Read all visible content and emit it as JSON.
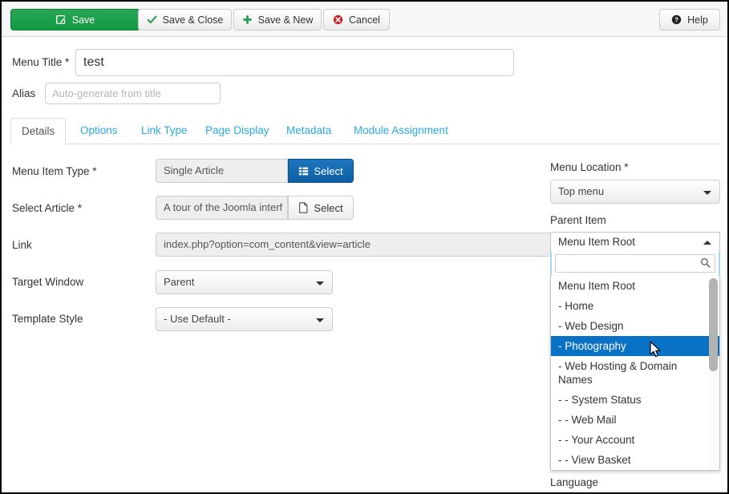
{
  "toolbar": {
    "save_label": "Save",
    "save_close_label": "Save & Close",
    "save_new_label": "Save & New",
    "cancel_label": "Cancel",
    "help_label": "Help",
    "save_color": "#159a42",
    "cancel_icon_color": "#c0262b",
    "check_icon_color": "#2a9d4f"
  },
  "form": {
    "menu_title_label": "Menu Title *",
    "menu_title_value": "test",
    "alias_label": "Alias",
    "alias_value": "",
    "alias_placeholder": "Auto-generate from title"
  },
  "tabs": [
    {
      "label": "Details",
      "active": true
    },
    {
      "label": "Options",
      "active": false
    },
    {
      "label": "Link Type",
      "active": false
    },
    {
      "label": "Page Display",
      "active": false
    },
    {
      "label": "Metadata",
      "active": false
    },
    {
      "label": "Module Assignment",
      "active": false
    }
  ],
  "details": {
    "menu_item_type_label": "Menu Item Type *",
    "menu_item_type_value": "Single Article",
    "menu_item_type_button": "Select",
    "select_article_label": "Select Article *",
    "select_article_value": "A tour of the Joomla interf",
    "select_article_button": "Select",
    "link_label": "Link",
    "link_value": "index.php?option=com_content&view=article",
    "target_window_label": "Target Window",
    "target_window_value": "Parent",
    "template_style_label": "Template Style",
    "template_style_value": "- Use Default -"
  },
  "right": {
    "menu_location_label": "Menu Location *",
    "menu_location_value": "Top menu",
    "parent_item_label": "Parent Item",
    "parent_item_value": "Menu Item Root",
    "language_label": "Language",
    "search_value": "",
    "search_placeholder": "",
    "highlight_color": "#0a72c4",
    "options": [
      {
        "label": "Menu Item Root",
        "selected": false
      },
      {
        "label": "- Home",
        "selected": false
      },
      {
        "label": "- Web Design",
        "selected": false
      },
      {
        "label": "- Photography",
        "selected": true
      },
      {
        "label": "- Web Hosting & Domain Names",
        "selected": false
      },
      {
        "label": "- - System Status",
        "selected": false
      },
      {
        "label": "- - Web Mail",
        "selected": false
      },
      {
        "label": "- - Your Account",
        "selected": false
      },
      {
        "label": "- - View Basket",
        "selected": false
      }
    ]
  }
}
